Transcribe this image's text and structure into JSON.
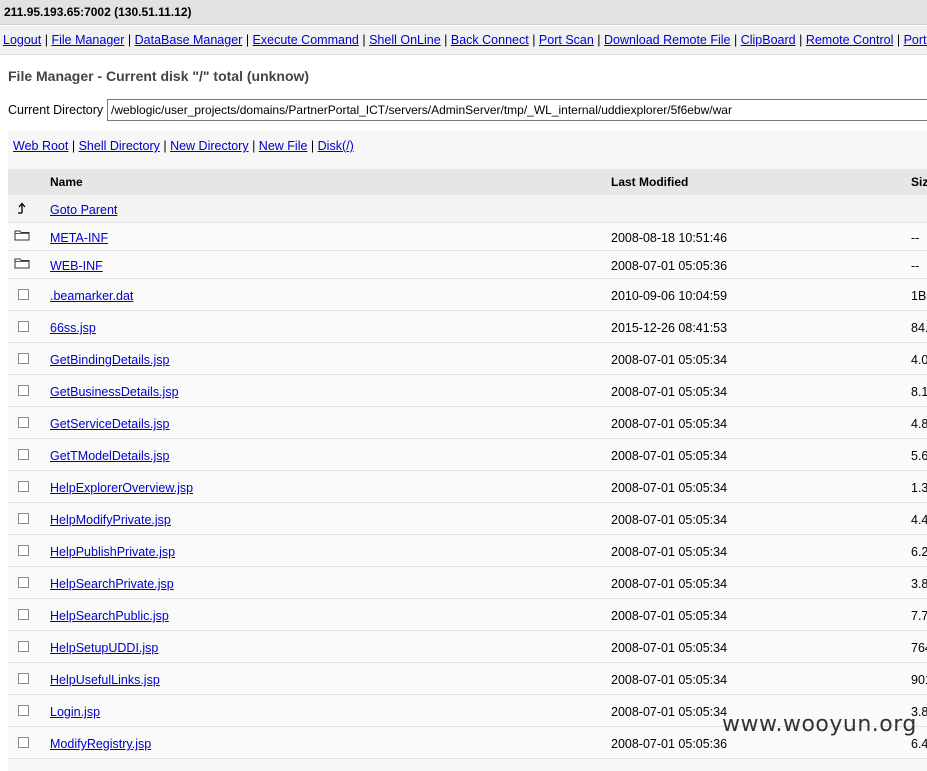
{
  "header": {
    "title": "211.95.193.65:7002 (130.51.11.12)"
  },
  "nav": [
    "Logout",
    "File Manager",
    "DataBase Manager",
    "Execute Command",
    "Shell OnLine",
    "Back Connect",
    "Port Scan",
    "Download Remote File",
    "ClipBoard",
    "Remote Control",
    "Port Map"
  ],
  "nav_separator": "|",
  "page_title": "File Manager - Current disk \"/\" total (unknow)",
  "current_directory": {
    "label": "Current Directory",
    "value": "/weblogic/user_projects/domains/PartnerPortal_ICT/servers/AdminServer/tmp/_WL_internal/uddiexplorer/5f6ebw/war"
  },
  "actions": [
    "Web Root",
    "Shell Directory",
    "New Directory",
    "New File",
    "Disk(/)"
  ],
  "table": {
    "headers": {
      "name": "Name",
      "modified": "Last Modified",
      "size": "Size"
    },
    "parent": {
      "icon": "up-arrow-icon",
      "label": "Goto Parent"
    },
    "dirs": [
      {
        "name": "META-INF",
        "modified": "2008-08-18 10:51:46",
        "size": "--",
        "icon": "folder-icon"
      },
      {
        "name": "WEB-INF",
        "modified": "2008-07-01 05:05:36",
        "size": "--",
        "icon": "folder-icon"
      }
    ],
    "files": [
      {
        "name": ".beamarker.dat",
        "modified": "2010-09-06 10:04:59",
        "size": "1B"
      },
      {
        "name": "66ss.jsp",
        "modified": "2015-12-26 08:41:53",
        "size": "84."
      },
      {
        "name": "GetBindingDetails.jsp",
        "modified": "2008-07-01 05:05:34",
        "size": "4.0"
      },
      {
        "name": "GetBusinessDetails.jsp",
        "modified": "2008-07-01 05:05:34",
        "size": "8.1"
      },
      {
        "name": "GetServiceDetails.jsp",
        "modified": "2008-07-01 05:05:34",
        "size": "4.8"
      },
      {
        "name": "GetTModelDetails.jsp",
        "modified": "2008-07-01 05:05:34",
        "size": "5.6"
      },
      {
        "name": "HelpExplorerOverview.jsp",
        "modified": "2008-07-01 05:05:34",
        "size": "1.3"
      },
      {
        "name": "HelpModifyPrivate.jsp",
        "modified": "2008-07-01 05:05:34",
        "size": "4.4"
      },
      {
        "name": "HelpPublishPrivate.jsp",
        "modified": "2008-07-01 05:05:34",
        "size": "6.2"
      },
      {
        "name": "HelpSearchPrivate.jsp",
        "modified": "2008-07-01 05:05:34",
        "size": "3.8"
      },
      {
        "name": "HelpSearchPublic.jsp",
        "modified": "2008-07-01 05:05:34",
        "size": "7.7"
      },
      {
        "name": "HelpSetupUDDI.jsp",
        "modified": "2008-07-01 05:05:34",
        "size": "764"
      },
      {
        "name": "HelpUsefulLinks.jsp",
        "modified": "2008-07-01 05:05:34",
        "size": "901"
      },
      {
        "name": "Login.jsp",
        "modified": "2008-07-01 05:05:34",
        "size": "3.8"
      },
      {
        "name": "ModifyRegistry.jsp",
        "modified": "2008-07-01 05:05:36",
        "size": "6.4"
      }
    ]
  },
  "watermark": "www.wooyun.org"
}
